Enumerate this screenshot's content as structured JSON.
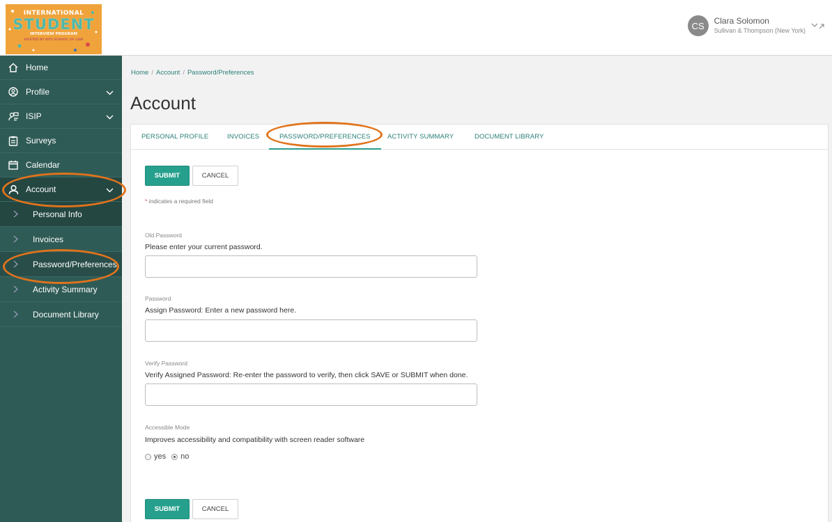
{
  "logo": {
    "line1": "INTERNATIONAL",
    "line2": "STUDENT",
    "line3": "INTERVIEW PROGRAM",
    "line4": "HOSTED BY NYU SCHOOL OF LAW"
  },
  "sidebar": {
    "items": [
      {
        "label": "Home",
        "icon": "home-icon"
      },
      {
        "label": "Profile",
        "icon": "profile-icon"
      },
      {
        "label": "ISIP",
        "icon": "isip-icon"
      },
      {
        "label": "Surveys",
        "icon": "clipboard-icon"
      },
      {
        "label": "Calendar",
        "icon": "calendar-icon"
      },
      {
        "label": "Account",
        "icon": "user-icon"
      }
    ],
    "account_sub": [
      {
        "label": "Personal Info"
      },
      {
        "label": "Invoices"
      },
      {
        "label": "Password/Preferences"
      },
      {
        "label": "Activity Summary"
      },
      {
        "label": "Document Library"
      }
    ]
  },
  "user": {
    "initials": "CS",
    "name": "Clara Solomon",
    "firm": "Sullivan & Thompson (New York)"
  },
  "breadcrumb": [
    "Home",
    "Account",
    "Password/Preferences"
  ],
  "page_title": "Account",
  "tabs": [
    {
      "label": "PERSONAL PROFILE"
    },
    {
      "label": "INVOICES"
    },
    {
      "label": "PASSWORD/PREFERENCES"
    },
    {
      "label": "ACTIVITY SUMMARY"
    },
    {
      "label": "DOCUMENT LIBRARY"
    }
  ],
  "buttons": {
    "submit": "SUBMIT",
    "cancel": "CANCEL"
  },
  "required_note": {
    "star": "*",
    "text": " indicates a required field"
  },
  "fields": {
    "old_password": {
      "label": "Old Password",
      "help": "Please enter your current password.",
      "value": ""
    },
    "password": {
      "label": "Password",
      "help": "Assign Password: Enter a new password here.",
      "value": ""
    },
    "verify": {
      "label": "Verify Password",
      "help": "Verify Assigned Password: Re-enter the password to verify, then click SAVE or SUBMIT when done.",
      "value": ""
    },
    "accessible": {
      "label": "Accessible Mode",
      "help": "Improves accessibility and compatibility with screen reader software",
      "yes": "yes",
      "no": "no",
      "selected": "no"
    }
  },
  "colors": {
    "sidebar": "#2f5b56",
    "accent": "#26a08d",
    "highlight": "#e0731c"
  }
}
